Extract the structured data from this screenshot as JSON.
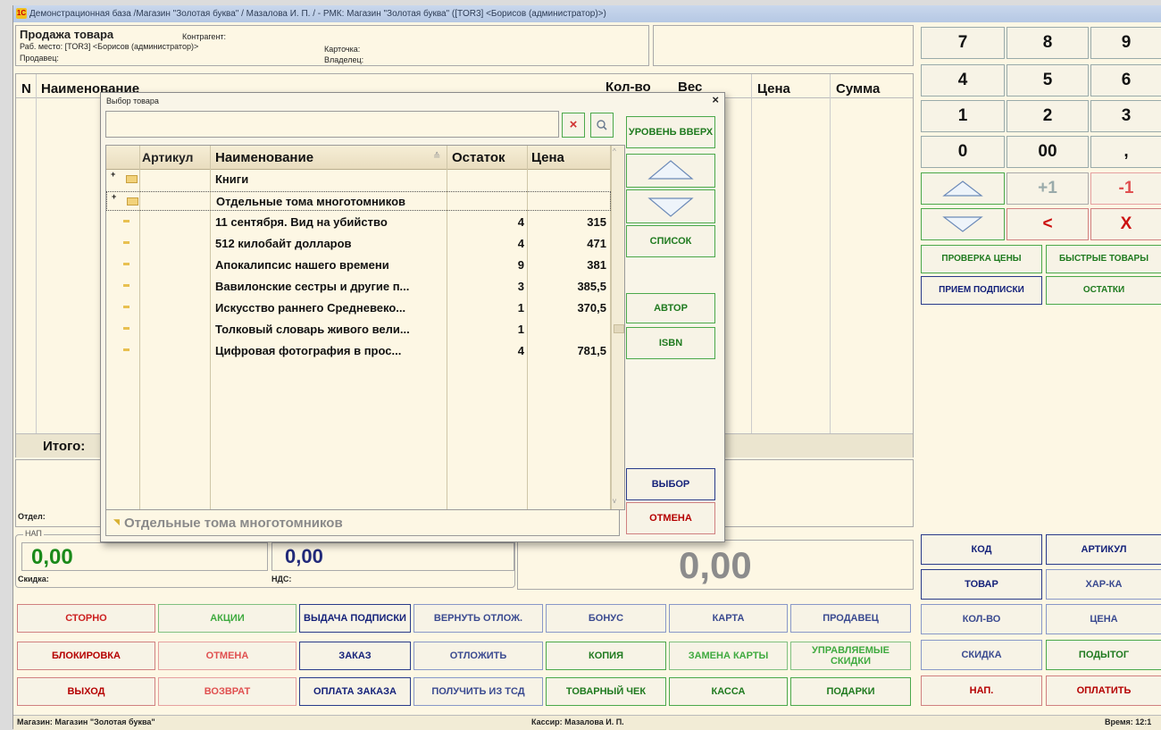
{
  "window": {
    "title": "Демонстрационная база /Магазин \"Золотая буква\" / Мазалова И. П. / - РМК: Магазин \"Золотая буква\" ([TOR3] <Борисов (администратор)>)",
    "logo": "1С"
  },
  "header": {
    "title": "Продажа товара",
    "workplace": "Раб. место: [TOR3] <Борисов (администратор)>",
    "seller": "Продавец:",
    "counterparty": "Контрагент:",
    "card": "Карточка:",
    "owner": "Владелец:"
  },
  "table": {
    "columns": [
      "N",
      "Наименование",
      "Кол-во",
      "Вес",
      "Цена",
      "Сумма"
    ],
    "total": "Итого:"
  },
  "dept": "Отдел:",
  "nap": {
    "legend": "НАП",
    "value1": "0,00",
    "value2": "0,00",
    "discount_label": "Скидка:",
    "vat_label": "НДС:",
    "total": "0,00"
  },
  "keypad": {
    "keys": [
      "7",
      "8",
      "9",
      "4",
      "5",
      "6",
      "1",
      "2",
      "3",
      "0",
      "00",
      ","
    ],
    "plus_one": "+1",
    "minus_one": "-1",
    "backspace": "<",
    "clear": "X"
  },
  "right_buttons": {
    "price_check": "ПРОВЕРКА ЦЕНЫ",
    "quick_goods": "БЫСТРЫЕ ТОВАРЫ",
    "subscription_receive": "ПРИЕМ ПОДПИСКИ",
    "remains": "ОСТАТКИ",
    "code": "КОД",
    "article": "АРТИКУЛ",
    "goods": "ТОВАР",
    "characteristic": "ХАР-КА",
    "quantity": "КОЛ-ВО",
    "price": "ЦЕНА",
    "discount": "СКИДКА",
    "subtotal": "ПОДЫТОГ",
    "nap": "НАП.",
    "pay": "ОПЛАТИТЬ"
  },
  "bottom_buttons": {
    "storno": "СТОРНО",
    "actions": "АКЦИИ",
    "subscription_issue": "ВЫДАЧА ПОДПИСКИ",
    "return_deferred": "ВЕРНУТЬ ОТЛОЖ.",
    "bonus": "БОНУС",
    "card": "КАРТА",
    "seller": "ПРОДАВЕЦ",
    "block": "БЛОКИРОВКА",
    "cancel": "ОТМЕНА",
    "order": "ЗАКАЗ",
    "defer": "ОТЛОЖИТЬ",
    "copy": "КОПИЯ",
    "replace_card": "ЗАМЕНА КАРТЫ",
    "managed_discounts": "УПРАВЛЯЕМЫЕ СКИДКИ",
    "exit": "ВЫХОД",
    "return": "ВОЗВРАТ",
    "order_payment": "ОПЛАТА ЗАКАЗА",
    "get_from_tsd": "ПОЛУЧИТЬ ИЗ ТСД",
    "sales_receipt": "ТОВАРНЫЙ ЧЕК",
    "cash": "КАССА",
    "gifts": "ПОДАРКИ"
  },
  "statusbar": {
    "shop": "Магазин: Магазин \"Золотая буква\"",
    "cashier": "Кассир: Мазалова И. П.",
    "time": "Время: 12:1"
  },
  "dialog": {
    "title": "Выбор товара",
    "close": "×",
    "search_value": "",
    "columns": [
      "Артикул",
      "Наименование",
      "Остаток",
      "Цена"
    ],
    "rows": [
      {
        "type": "folder",
        "name": "Книги",
        "stock": "",
        "price": ""
      },
      {
        "type": "folder",
        "name": "Отдельные тома многотомников",
        "stock": "",
        "price": "",
        "selected": true
      },
      {
        "type": "item",
        "name": "11 сентября. Вид на убийство",
        "stock": "4",
        "price": "315"
      },
      {
        "type": "item",
        "name": "512 килобайт долларов",
        "stock": "4",
        "price": "471"
      },
      {
        "type": "item",
        "name": "Апокалипсис нашего времени",
        "stock": "9",
        "price": "381"
      },
      {
        "type": "item",
        "name": "Вавилонские сестры и другие п...",
        "stock": "3",
        "price": "385,5"
      },
      {
        "type": "item",
        "name": "Искусство раннего Средневеко...",
        "stock": "1",
        "price": "370,5"
      },
      {
        "type": "item",
        "name": "Толковый словарь живого вели...",
        "stock": "1",
        "price": ""
      },
      {
        "type": "item",
        "name": "Цифровая фотография в прос...",
        "stock": "4",
        "price": "781,5"
      }
    ],
    "path": "Отдельные тома многотомников",
    "buttons": {
      "level_up": "УРОВЕНЬ ВВЕРХ",
      "list": "СПИСОК",
      "author": "АВТОР",
      "isbn": "ISBN",
      "select": "ВЫБОР",
      "cancel": "ОТМЕНА"
    }
  }
}
